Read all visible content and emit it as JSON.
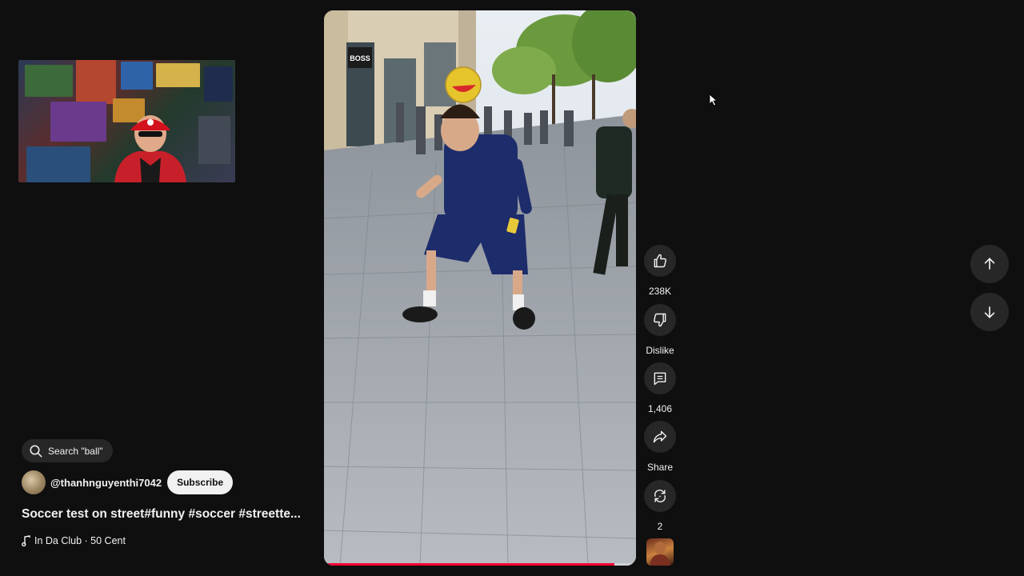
{
  "search_chip": {
    "label": "Search \"ball\""
  },
  "channel": {
    "handle": "@thanhnguyenthi7042",
    "subscribe_label": "Subscribe"
  },
  "video": {
    "title": "Soccer test on street#funny #soccer #streette...",
    "progress_fraction": 0.93,
    "storefront_sign": "BOSS"
  },
  "music": {
    "track": "In Da Club · 50 Cent"
  },
  "actions": {
    "like": {
      "icon": "thumbs-up-icon",
      "label": "238K"
    },
    "dislike": {
      "icon": "thumbs-down-icon",
      "label": "Dislike"
    },
    "comments": {
      "icon": "comment-icon",
      "label": "1,406"
    },
    "share": {
      "icon": "share-icon",
      "label": "Share"
    },
    "remix": {
      "icon": "remix-icon",
      "label": "2"
    }
  },
  "navigation": {
    "previous_icon": "arrow-up-icon",
    "next_icon": "arrow-down-icon"
  },
  "colors": {
    "background": "#0f0f0f",
    "button_bg": "#272727",
    "progress": "#ff0033",
    "subscribe_bg": "#f1f1f1"
  }
}
